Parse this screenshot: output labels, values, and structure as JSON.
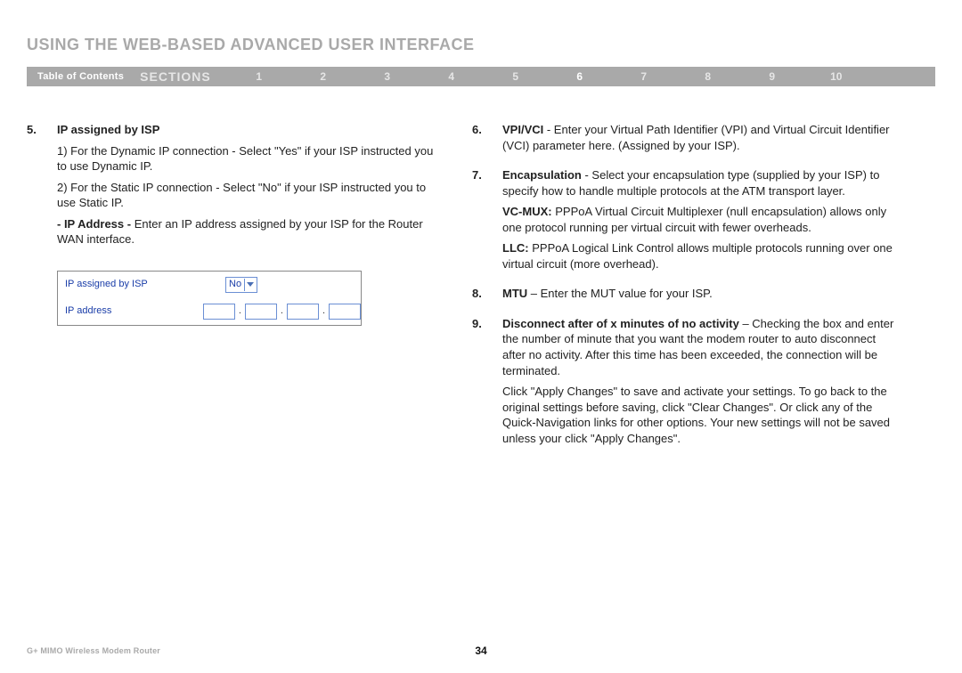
{
  "title": "USING THE WEB-BASED ADVANCED USER INTERFACE",
  "nav": {
    "toc": "Table of Contents",
    "sections": "SECTIONS",
    "items": [
      "1",
      "2",
      "3",
      "4",
      "5",
      "6",
      "7",
      "8",
      "9",
      "10"
    ],
    "activeIndex": 5
  },
  "left": {
    "item5": {
      "num": "5.",
      "heading": "IP assigned by ISP",
      "p1": "1) For the Dynamic IP connection - Select \"Yes\" if your ISP instructed you to use Dynamic IP.",
      "p2": "2) For the Static IP connection - Select \"No\" if your ISP instructed you to use Static IP.",
      "p3_lead": "- IP Address - ",
      "p3_rest": "Enter an IP address assigned by your ISP for the Router WAN interface."
    },
    "form": {
      "row1_label": "IP assigned by ISP",
      "row1_value": "No",
      "row2_label": "IP address"
    }
  },
  "right": {
    "item6": {
      "num": "6.",
      "lead": "VPI/VCI",
      "rest": " - Enter your Virtual Path Identifier (VPI) and Virtual Circuit Identifier (VCI) parameter here. (Assigned by your ISP)."
    },
    "item7": {
      "num": "7.",
      "lead": "Encapsulation",
      "rest": " - Select your encapsulation type (supplied by your ISP) to specify how to handle multiple protocols at the ATM transport layer.",
      "vcmux_lead": "VC-MUX:",
      "vcmux_rest": " PPPoA Virtual Circuit Multiplexer (null encapsulation) allows only one protocol running per virtual circuit with fewer overheads.",
      "llc_lead": "LLC:",
      "llc_rest": " PPPoA Logical Link Control allows multiple protocols running over one virtual circuit (more overhead)."
    },
    "item8": {
      "num": "8.",
      "lead": "MTU",
      "rest": " – Enter the MUT value for your ISP."
    },
    "item9": {
      "num": "9.",
      "lead": "Disconnect after of x minutes of no activity",
      "rest": " – Checking the box and enter the number of minute that you want the modem router to auto disconnect after no activity. After this time has been exceeded, the connection will be terminated.",
      "p2": "Click \"Apply Changes\" to save and activate your settings. To go back to the original settings before saving, click \"Clear Changes\". Or click any of the Quick-Navigation links for other options. Your new settings will not be saved unless your click \"Apply Changes\"."
    }
  },
  "footer": {
    "product": "G+ MIMO Wireless Modem Router",
    "page": "34"
  }
}
